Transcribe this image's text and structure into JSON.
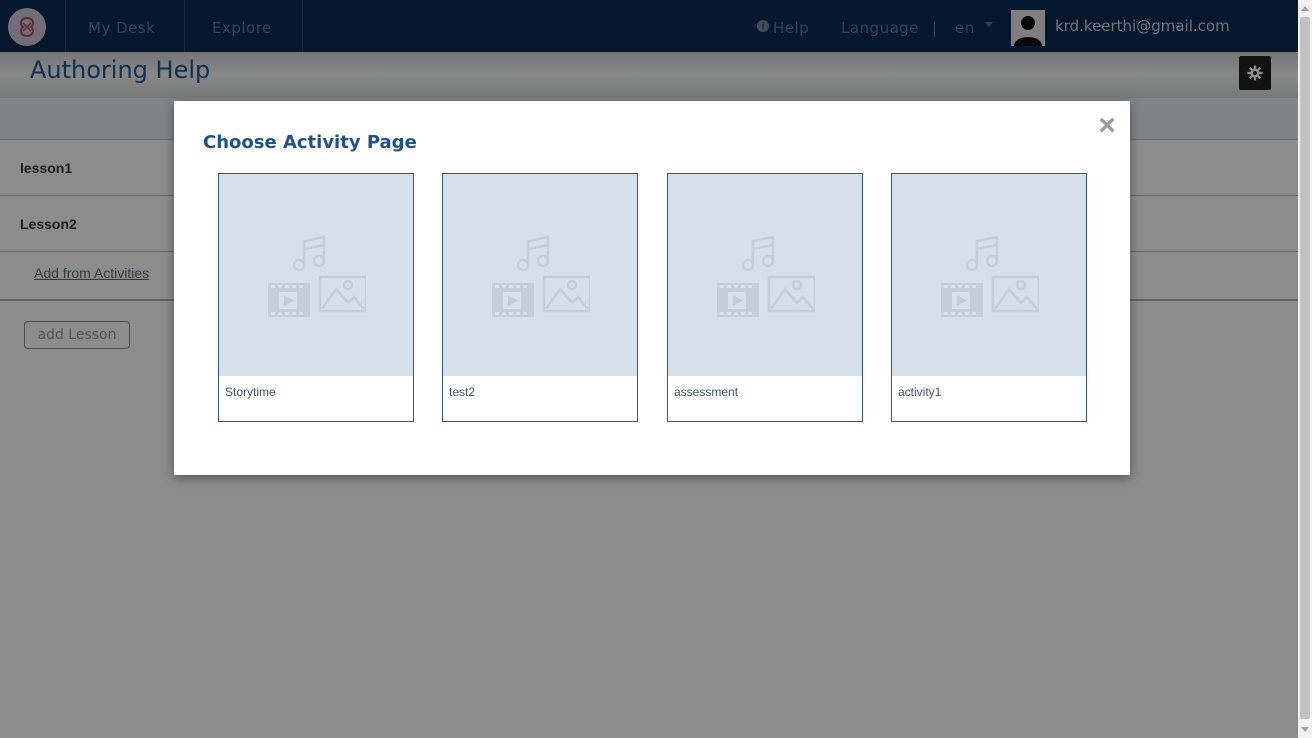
{
  "nav": {
    "my_desk": "My Desk",
    "explore": "Explore",
    "help": "Help",
    "language": "Language",
    "separator": "|",
    "language_value": "en",
    "user_email": "krd.keerthi@gmail.com",
    "logo_icon": "ekstep-logo-icon"
  },
  "page": {
    "title": "Authoring Help",
    "settings_icon": "gear-icon"
  },
  "lessons": [
    {
      "label": "lesson1"
    },
    {
      "label": "Lesson2"
    }
  ],
  "add_from_activities": "Add from Activities",
  "add_lesson_button": "add Lesson",
  "modal": {
    "title": "Choose Activity Page",
    "close_symbol": "×",
    "cards": [
      {
        "label": "Storytime"
      },
      {
        "label": "test2"
      },
      {
        "label": "assessment"
      },
      {
        "label": "activity1"
      }
    ]
  },
  "colors": {
    "nav_background": "#0c2d54",
    "title_blue": "#1a5c96",
    "card_border": "#2e5a86",
    "thumb_background": "#d6e0e8"
  }
}
